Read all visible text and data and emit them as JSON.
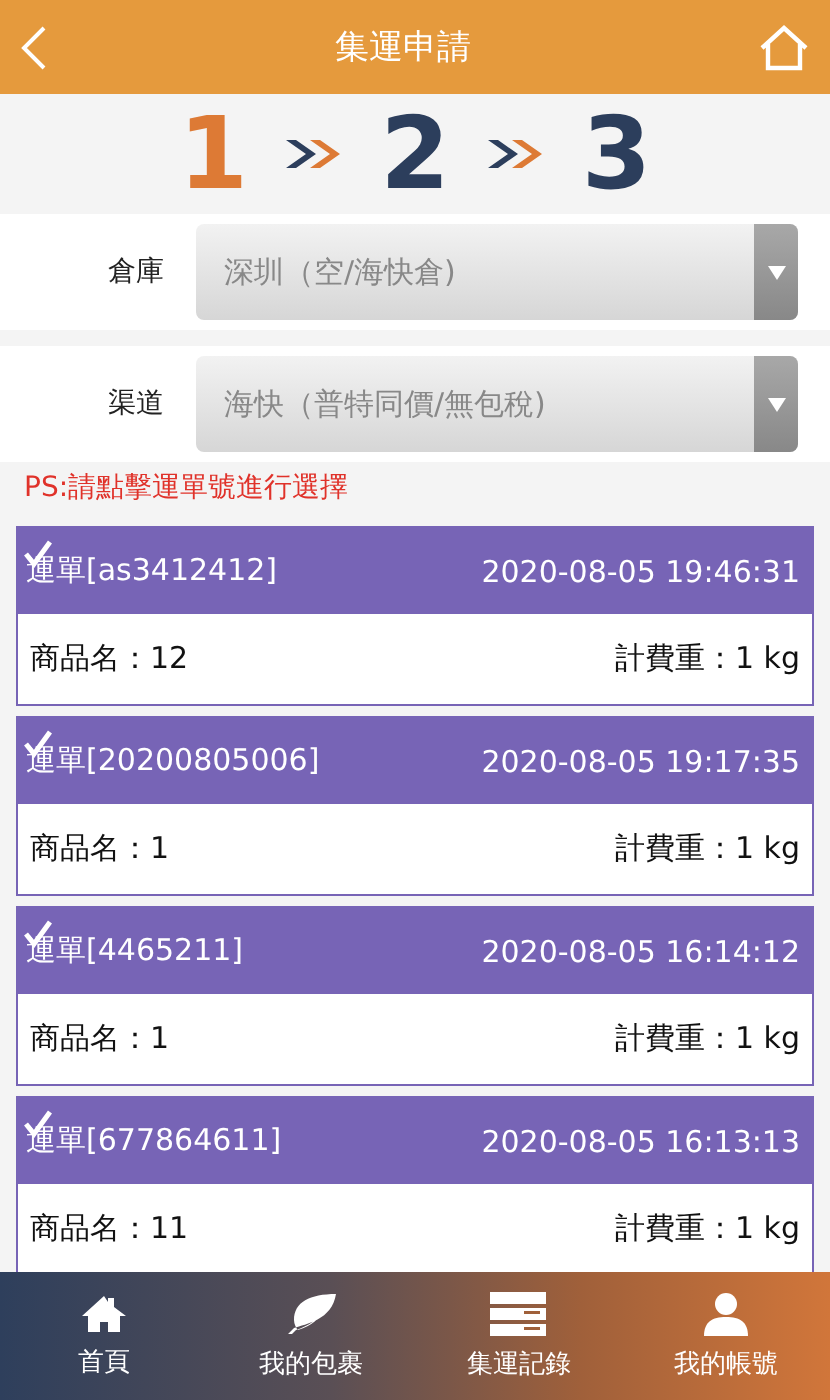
{
  "header": {
    "title": "集運申請"
  },
  "steps": [
    {
      "label": "1",
      "current": true
    },
    {
      "label": "2",
      "current": false
    },
    {
      "label": "3",
      "current": false
    }
  ],
  "fields": [
    {
      "label": "倉庫",
      "value": "深圳（空/海快倉)"
    },
    {
      "label": "渠道",
      "value": "海快（普特同價/無包稅)"
    }
  ],
  "notice": "PS:請點擊運單號進行選擇",
  "waybills": [
    {
      "title": "運單[as3412412]",
      "time": "2020-08-05 19:46:31",
      "product": "商品名：12",
      "weight": "計費重：1 kg",
      "checked": true
    },
    {
      "title": "運單[20200805006]",
      "time": "2020-08-05 19:17:35",
      "product": "商品名：1",
      "weight": "計費重：1 kg",
      "checked": true
    },
    {
      "title": "運單[4465211]",
      "time": "2020-08-05 16:14:12",
      "product": "商品名：1",
      "weight": "計費重：1 kg",
      "checked": true
    },
    {
      "title": "運單[677864611]",
      "time": "2020-08-05 16:13:13",
      "product": "商品名：11",
      "weight": "計費重：1 kg",
      "checked": true
    }
  ],
  "nav": [
    {
      "label": "首頁",
      "kind": "home"
    },
    {
      "label": "我的包裹",
      "kind": "leaf"
    },
    {
      "label": "集運記錄",
      "kind": "list"
    },
    {
      "label": "我的帳號",
      "kind": "user"
    }
  ]
}
